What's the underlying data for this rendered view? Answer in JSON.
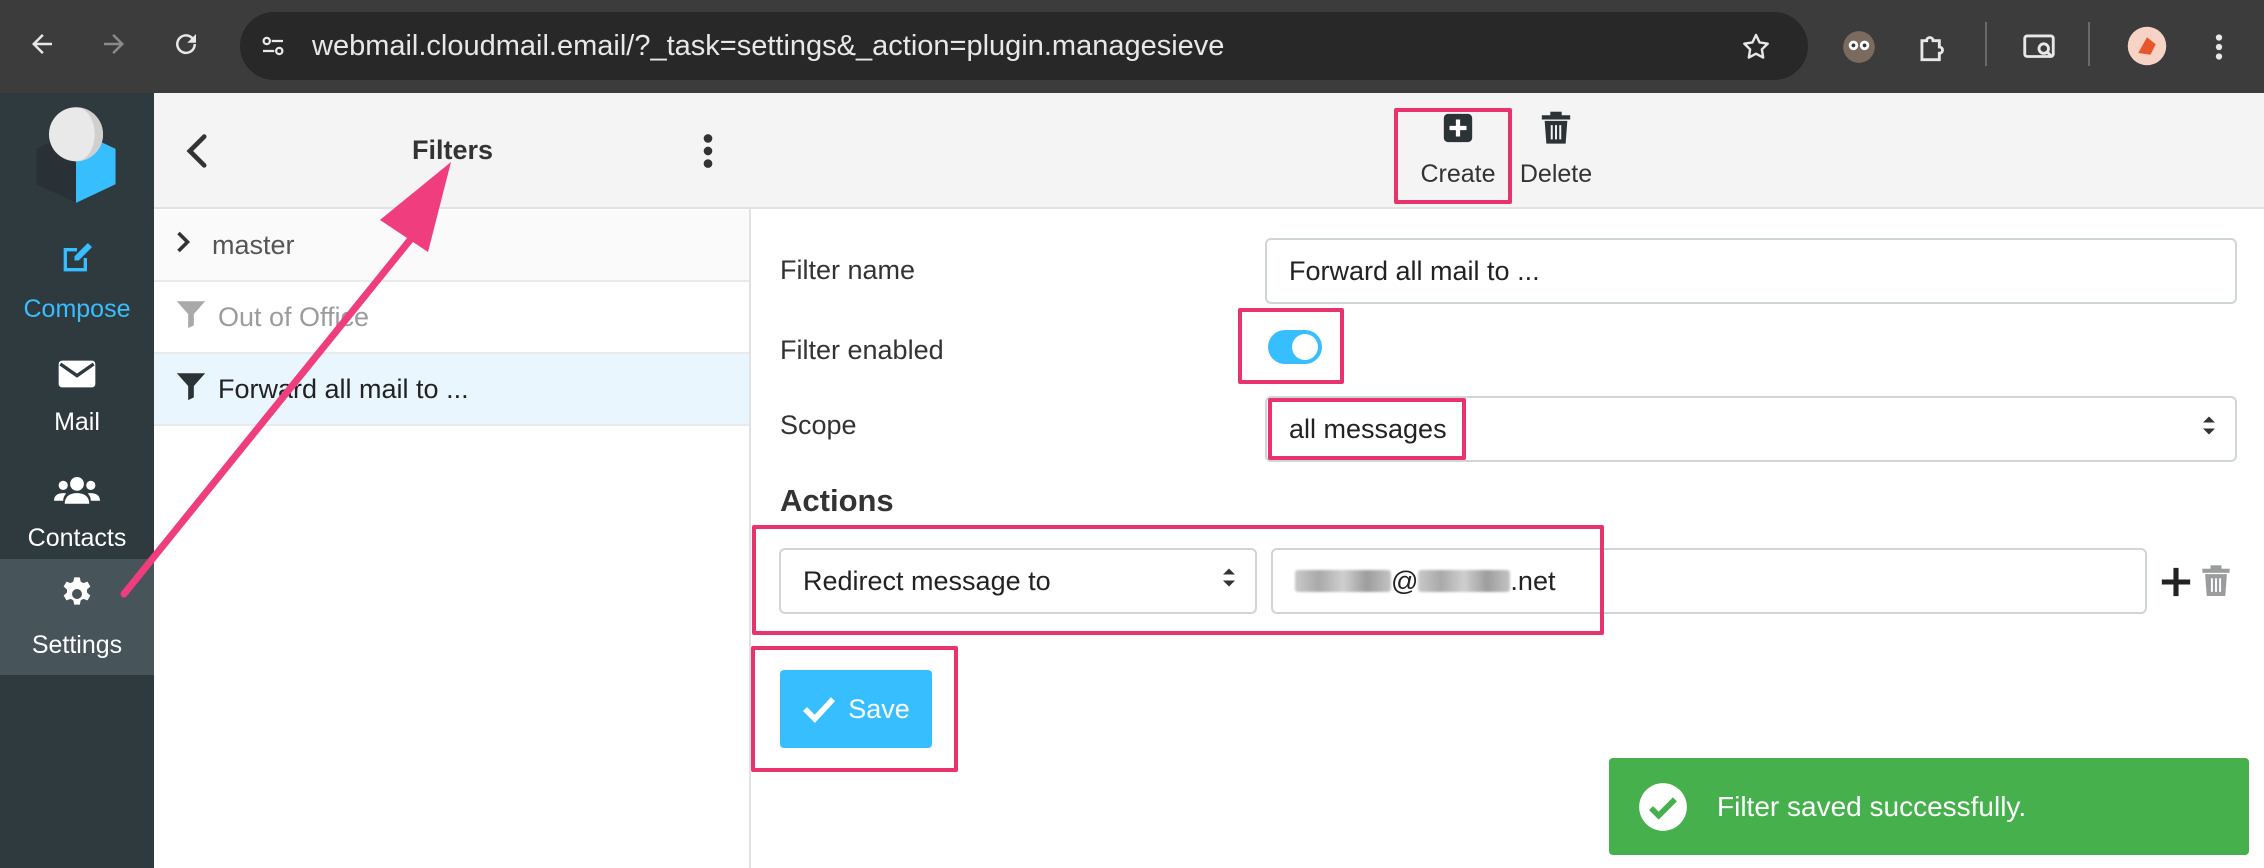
{
  "browser": {
    "url": "webmail.cloudmail.email/?_task=settings&_action=plugin.managesieve"
  },
  "app_nav": {
    "items": [
      {
        "label": "Compose",
        "icon": "compose-icon"
      },
      {
        "label": "Mail",
        "icon": "envelope-icon"
      },
      {
        "label": "Contacts",
        "icon": "users-icon"
      },
      {
        "label": "Settings",
        "icon": "gear-icon"
      }
    ]
  },
  "filters_panel": {
    "title": "Filters",
    "group": "master",
    "items": [
      {
        "label": "Out of Office",
        "enabled": false
      },
      {
        "label": "Forward all mail to ...",
        "enabled": true,
        "selected": true
      }
    ]
  },
  "toolbar": {
    "create_label": "Create",
    "delete_label": "Delete"
  },
  "form": {
    "filter_name_label": "Filter name",
    "filter_name_value": "Forward all mail to ...",
    "filter_enabled_label": "Filter enabled",
    "filter_enabled": true,
    "scope_label": "Scope",
    "scope_value": "all messages",
    "actions_heading": "Actions",
    "action_type": "Redirect message to",
    "action_target_suffix_at": "@",
    "action_target_suffix": ".net",
    "save_label": "Save"
  },
  "toast": {
    "message": "Filter saved successfully."
  },
  "colors": {
    "accent": "#37beff",
    "highlight": "#e8336d",
    "success": "#45b04c",
    "sidebar": "#2f3a3f"
  }
}
